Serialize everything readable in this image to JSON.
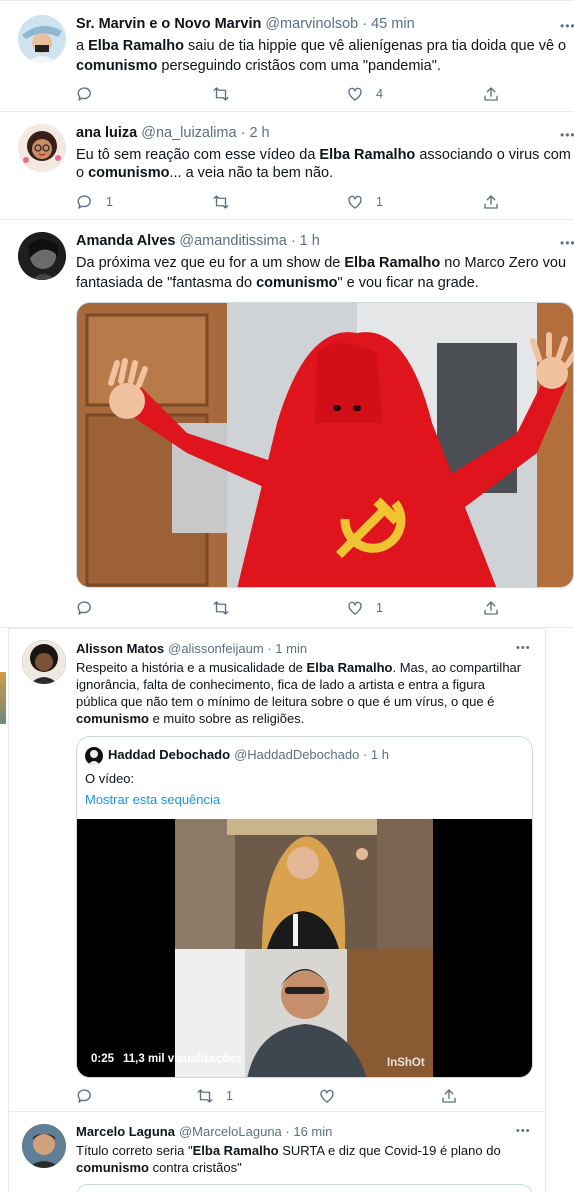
{
  "tweets": [
    {
      "name": "Sr. Marvin e o Novo Marvin",
      "handle": "@marvinolsob",
      "time": "· 45 min",
      "lines": [
        [
          "a ",
          "Elba Ramalho",
          " saiu de tia hippie que vê alienígenas pra tia doida que vê o"
        ],
        [
          "",
          "comunismo",
          " perseguindo cristãos com uma \"pandemia\"."
        ]
      ],
      "likes": "4"
    },
    {
      "name": "ana luiza",
      "handle": "@na_luizalima",
      "time": "· 2 h",
      "lines": [
        [
          "Eu tô sem reação com esse vídeo da ",
          "Elba Ramalho",
          " associando o virus com"
        ],
        [
          "o ",
          "comunismo",
          "... a veia não ta bem não."
        ]
      ],
      "replies": "1",
      "likes": "1"
    },
    {
      "name": "Amanda Alves",
      "handle": "@amanditissima",
      "time": "· 1 h",
      "lines": [
        [
          "Da próxima vez que eu for a um show de ",
          "Elba Ramalho",
          " no Marco Zero vou"
        ],
        [
          "fantasiada de \"fantasma do ",
          "comunismo",
          "\" e vou ficar na grade."
        ]
      ],
      "likes": "1"
    },
    {
      "name": "Alisson Matos",
      "handle": "@alissonfeijaum",
      "time": "· 1 min",
      "lines": [
        [
          "Respeito a história e a musicalidade de ",
          "Elba Ramalho",
          ". Mas, ao compartilhar"
        ],
        [
          "ignorância, falta de conhecimento, fica de lado a artista e entra a figura",
          "",
          ""
        ],
        [
          "pública que não tem o mínimo de leitura sobre o que é um vírus, o que é",
          "",
          ""
        ],
        [
          "",
          "comunismo",
          " e muito sobre as religiões."
        ]
      ],
      "retweets": "1",
      "quote": {
        "name": "Haddad Debochado",
        "handle": "@HaddadDebochado",
        "time": "· 1 h",
        "text": "O vídeo:",
        "show_thread": "Mostrar esta sequência",
        "video_time": "0:25",
        "views": "11,3 mil visualizações",
        "watermark": "InShOt"
      }
    },
    {
      "name": "Marcelo Laguna",
      "handle": "@MarceloLaguna",
      "time": "· 16 min",
      "lines": [
        [
          "Título correto seria \"",
          "Elba Ramalho",
          " SURTA e diz que Covid-19 é plano do"
        ],
        [
          "",
          "comunismo",
          " contra cristãos\""
        ]
      ]
    }
  ],
  "more_label": "•••",
  "icons": [
    "reply-icon",
    "retweet-icon",
    "like-icon",
    "share-icon"
  ],
  "colors": {
    "link": "#1b95e0",
    "secondary": "#5b7083",
    "hammer_sickle": "#f0c330",
    "cloth": "#e0141c"
  }
}
